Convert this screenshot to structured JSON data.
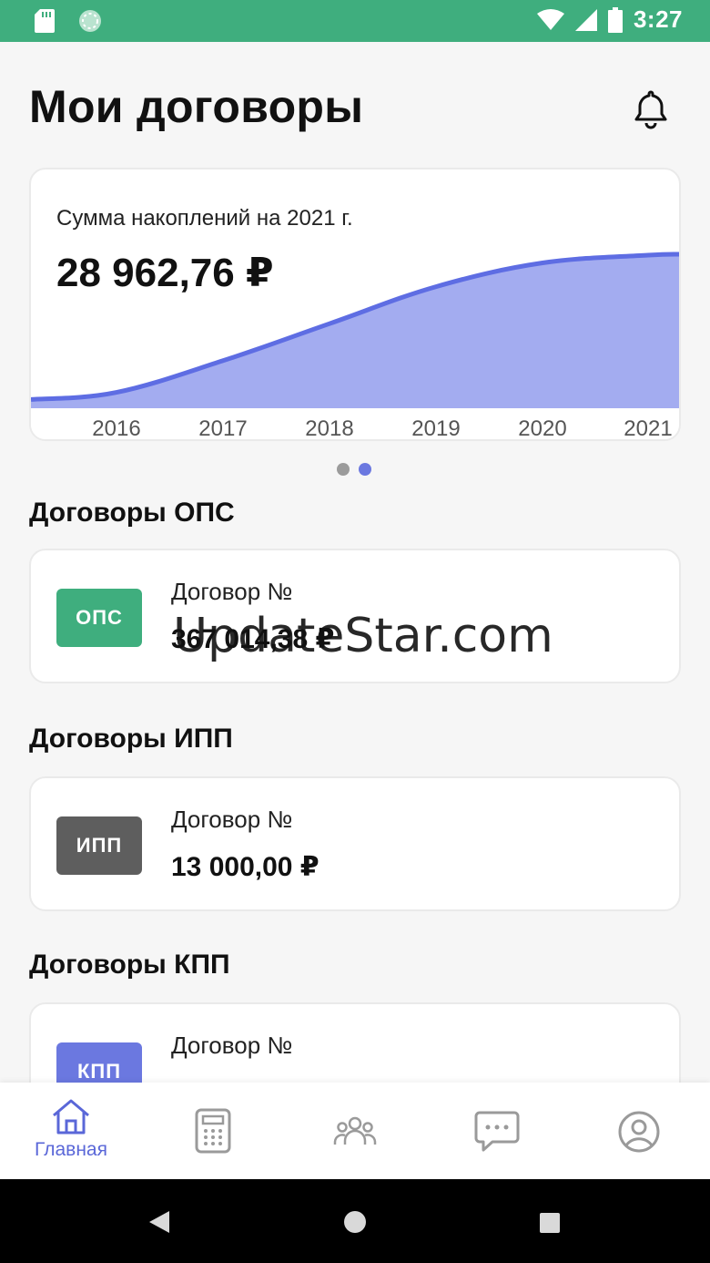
{
  "status_bar": {
    "time": "3:27"
  },
  "header": {
    "title": "Мои договоры"
  },
  "summary": {
    "label": "Сумма накоплений на 2021 г.",
    "value": "28 962,76 ₽"
  },
  "chart_data": {
    "type": "area",
    "x": [
      "2016",
      "2017",
      "2018",
      "2019",
      "2020",
      "2021"
    ],
    "series": [
      {
        "values": [
          3000,
          9000,
          16000,
          23000,
          27500,
          28962.76
        ]
      }
    ],
    "colors": {
      "fill": "#a3acf0",
      "line": "#5e6de3"
    }
  },
  "carousel": {
    "pages": 2,
    "active_index": 1
  },
  "sections": {
    "ops": {
      "title": "Договоры ОПС",
      "badge": "ОПС",
      "badge_color": "#3fae7e",
      "contract_label": "Договор №",
      "amount": "367 014,38 ₽"
    },
    "ipp": {
      "title": "Договоры ИПП",
      "badge": "ИПП",
      "badge_color": "#5e5e5e",
      "contract_label": "Договор №",
      "amount": "13 000,00 ₽"
    },
    "kpp": {
      "title": "Договоры КПП",
      "badge": "КПП",
      "badge_color": "#6b78e0",
      "contract_label": "Договор №",
      "amount": ""
    }
  },
  "watermark": "UpdateStar.com",
  "bottom_nav": {
    "items": [
      {
        "icon": "home-icon",
        "label": "Главная",
        "active": true
      },
      {
        "icon": "calculator-icon",
        "label": ""
      },
      {
        "icon": "people-icon",
        "label": ""
      },
      {
        "icon": "chat-icon",
        "label": ""
      },
      {
        "icon": "profile-icon",
        "label": ""
      }
    ],
    "accent": "#5a67d8",
    "inactive": "#9a9a9a"
  }
}
